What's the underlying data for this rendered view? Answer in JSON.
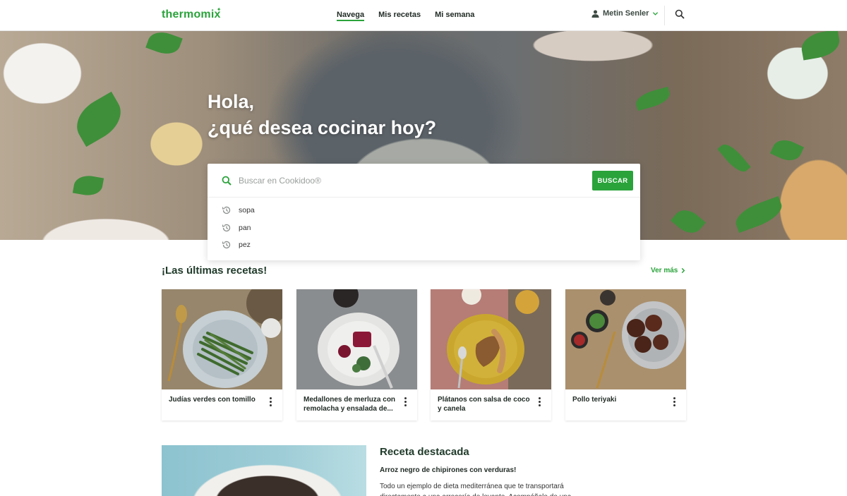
{
  "header": {
    "logo": "thermomix",
    "nav": [
      {
        "label": "Navega",
        "active": true
      },
      {
        "label": "Mis recetas",
        "active": false
      },
      {
        "label": "Mi semana",
        "active": false
      }
    ],
    "user_name": "Metin Senler"
  },
  "hero": {
    "greeting": "Hola,",
    "question": "¿qué desea cocinar hoy?"
  },
  "search": {
    "placeholder": "Buscar en Cookidoo®",
    "button_label": "BUSCAR",
    "history": [
      "sopa",
      "pan",
      "pez"
    ]
  },
  "latest": {
    "title": "¡Las últimas recetas!",
    "see_more": "Ver más",
    "recipes": [
      {
        "title": "Judías verdes con tomillo"
      },
      {
        "title": "Medallones de merluza con remolacha y ensalada de..."
      },
      {
        "title": "Plátanos con salsa de coco y canela"
      },
      {
        "title": "Pollo teriyaki"
      }
    ]
  },
  "featured": {
    "title": "Receta destacada",
    "recipe_name": "Arroz negro de chipirones con verduras!",
    "description": "Todo un ejemplo de dieta mediterránea que te transportará directamente a una arrocería de levante. Acompáñalo de una"
  },
  "colors": {
    "brand_green": "#2aa33b",
    "dark_green_text": "#1f3a2a"
  },
  "icons": [
    "user-icon",
    "chevron-down-icon",
    "search-icon",
    "history-icon",
    "chevron-right-icon",
    "more-vert-icon"
  ]
}
